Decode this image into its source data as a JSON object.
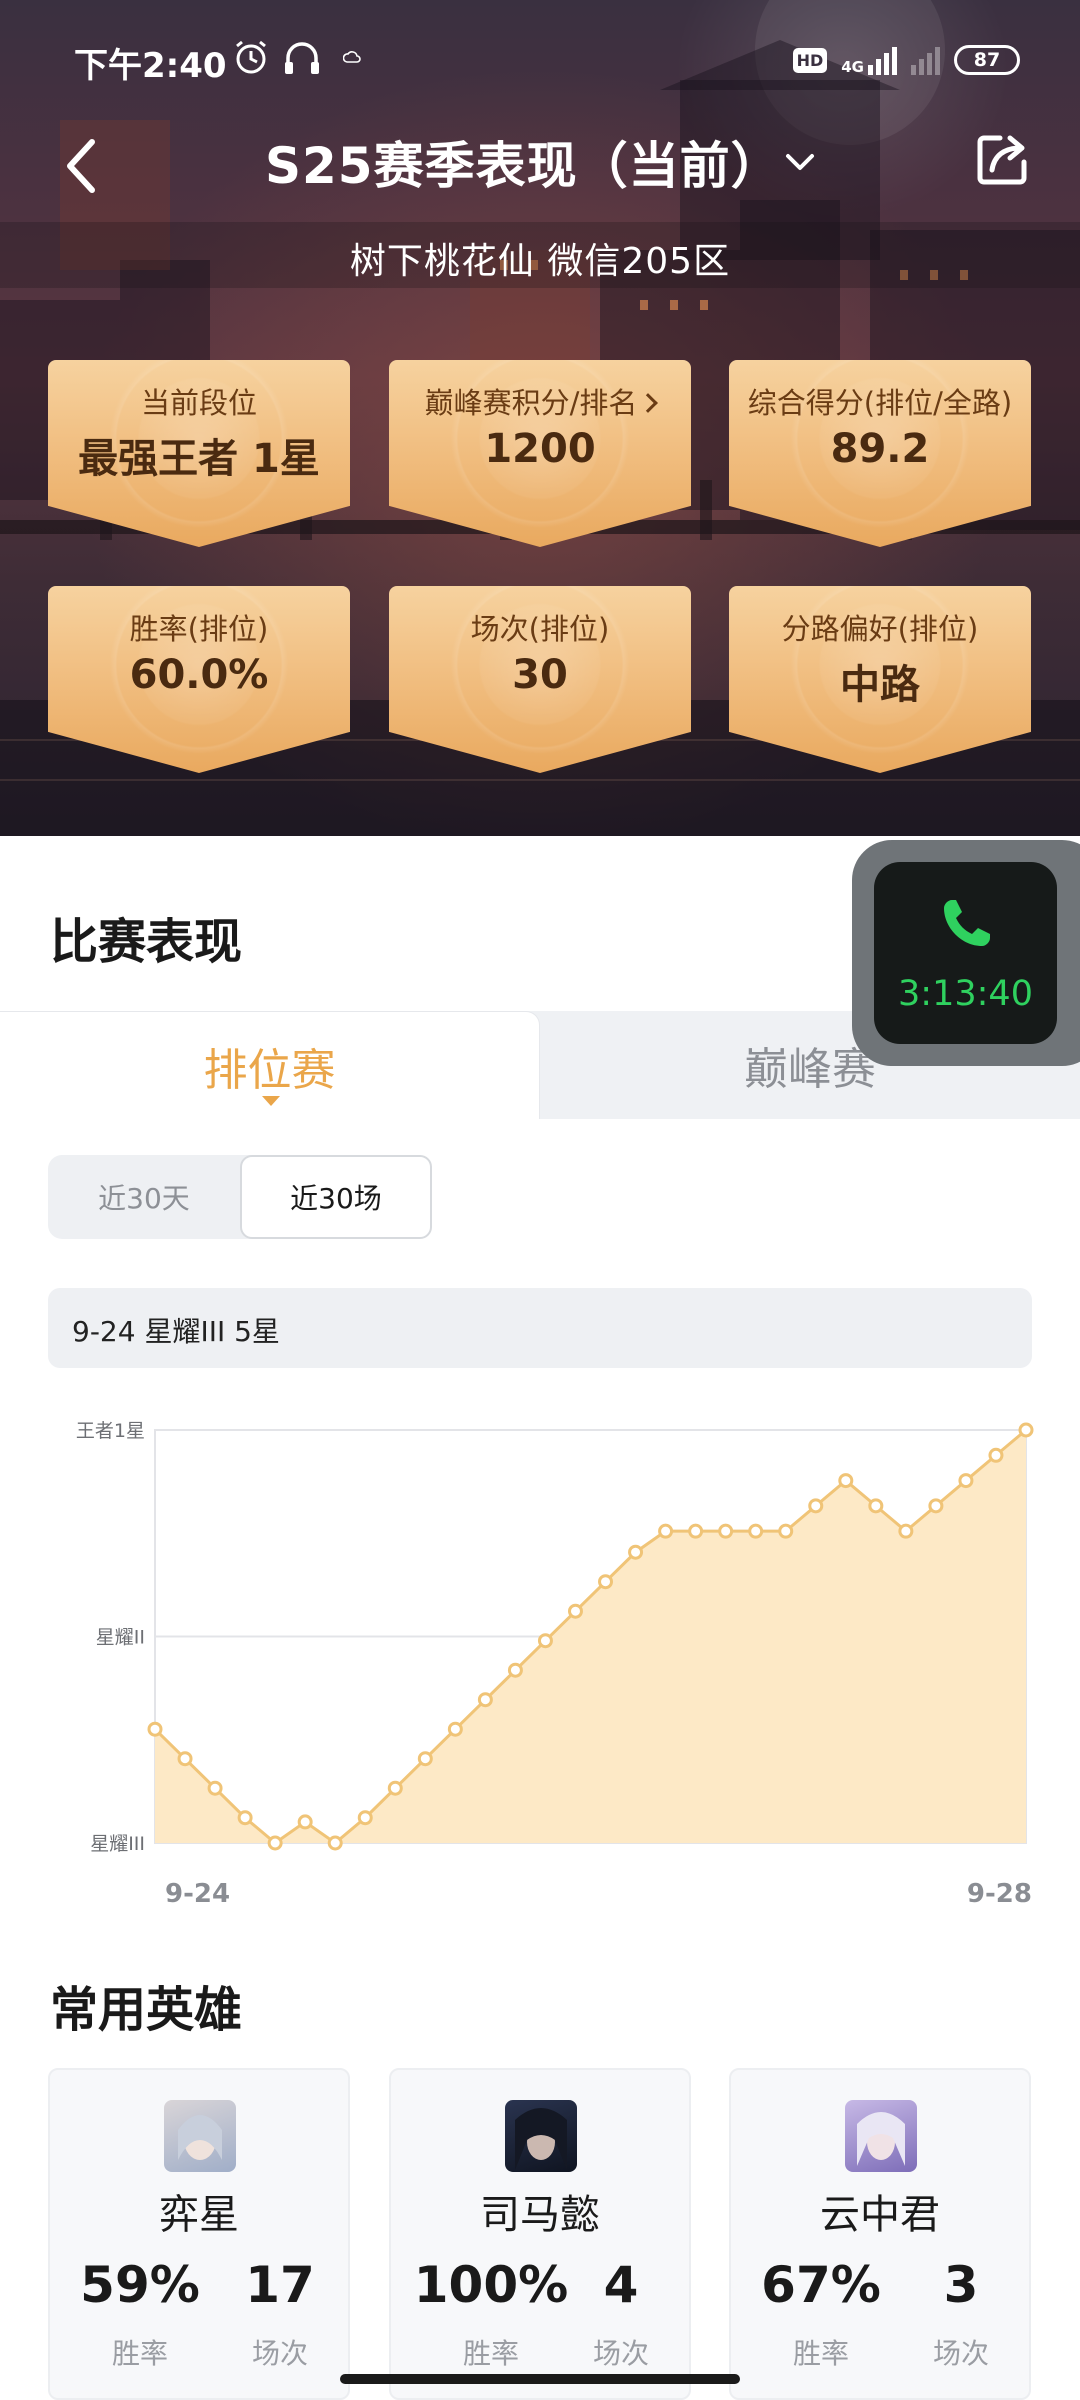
{
  "status_bar": {
    "time": "下午2:40",
    "hd": "HD",
    "network": "4G",
    "battery": "87",
    "icons": [
      "alarm-icon",
      "headphones-icon",
      "cloud-icon"
    ]
  },
  "nav": {
    "title": "S25赛季表现（当前）",
    "back_icon": "chevron-left-icon",
    "dropdown_icon": "chevron-down-icon",
    "share_icon": "share-icon"
  },
  "player": {
    "name_line": "树下桃花仙  微信205区"
  },
  "stats": [
    {
      "label": "当前段位",
      "value": "最强王者 1星"
    },
    {
      "label": "巅峰赛积分/排名",
      "value": "1200",
      "has_chevron": true
    },
    {
      "label": "综合得分(排位/全路)",
      "value": "89.2"
    },
    {
      "label": "胜率(排位)",
      "value": "60.0%"
    },
    {
      "label": "场次(排位)",
      "value": "30"
    },
    {
      "label": "分路偏好(排位)",
      "value": "中路"
    }
  ],
  "call_overlay": {
    "icon": "phone-icon",
    "timer": "3:13:40"
  },
  "match_section": {
    "title": "比赛表现",
    "tabs": [
      {
        "label": "排位赛",
        "active": true
      },
      {
        "label": "巅峰赛",
        "active": false
      }
    ],
    "segments": [
      {
        "label": "近30天",
        "active": false
      },
      {
        "label": "近30场",
        "active": true
      }
    ],
    "info": "9-24 星耀III 5星"
  },
  "chart_data": {
    "type": "area",
    "y_ticks": [
      "王者1星",
      "星耀II",
      "星耀III"
    ],
    "x_tick_labels": [
      "9-24",
      "9-28"
    ],
    "colors": {
      "line": "#f0c477",
      "fill": "#fde9c6",
      "marker_fill": "#ffffff",
      "grid": "#e3e4e8"
    },
    "ylim": [
      0,
      100
    ],
    "values": [
      53,
      46,
      39,
      32,
      26,
      31,
      26,
      32,
      39,
      46,
      53,
      60,
      67,
      74,
      81,
      88,
      95,
      100,
      100,
      100,
      100,
      100,
      106,
      112,
      106,
      100,
      106,
      112,
      118,
      124
    ],
    "grid": true
  },
  "heroes_section": {
    "title": "常用英雄",
    "heroes": [
      {
        "name": "弈星",
        "winrate": "59%",
        "games": "17",
        "winrate_label": "胜率",
        "games_label": "场次",
        "avatar_colors": [
          "#a9b6cf",
          "#e6ddd6"
        ]
      },
      {
        "name": "司马懿",
        "winrate": "100%",
        "games": "4",
        "winrate_label": "胜率",
        "games_label": "场次",
        "avatar_colors": [
          "#1a1f2e",
          "#3c4a6a"
        ]
      },
      {
        "name": "云中君",
        "winrate": "67%",
        "games": "3",
        "winrate_label": "胜率",
        "games_label": "场次",
        "avatar_colors": [
          "#c9c2e8",
          "#8a7bc0"
        ]
      }
    ]
  }
}
